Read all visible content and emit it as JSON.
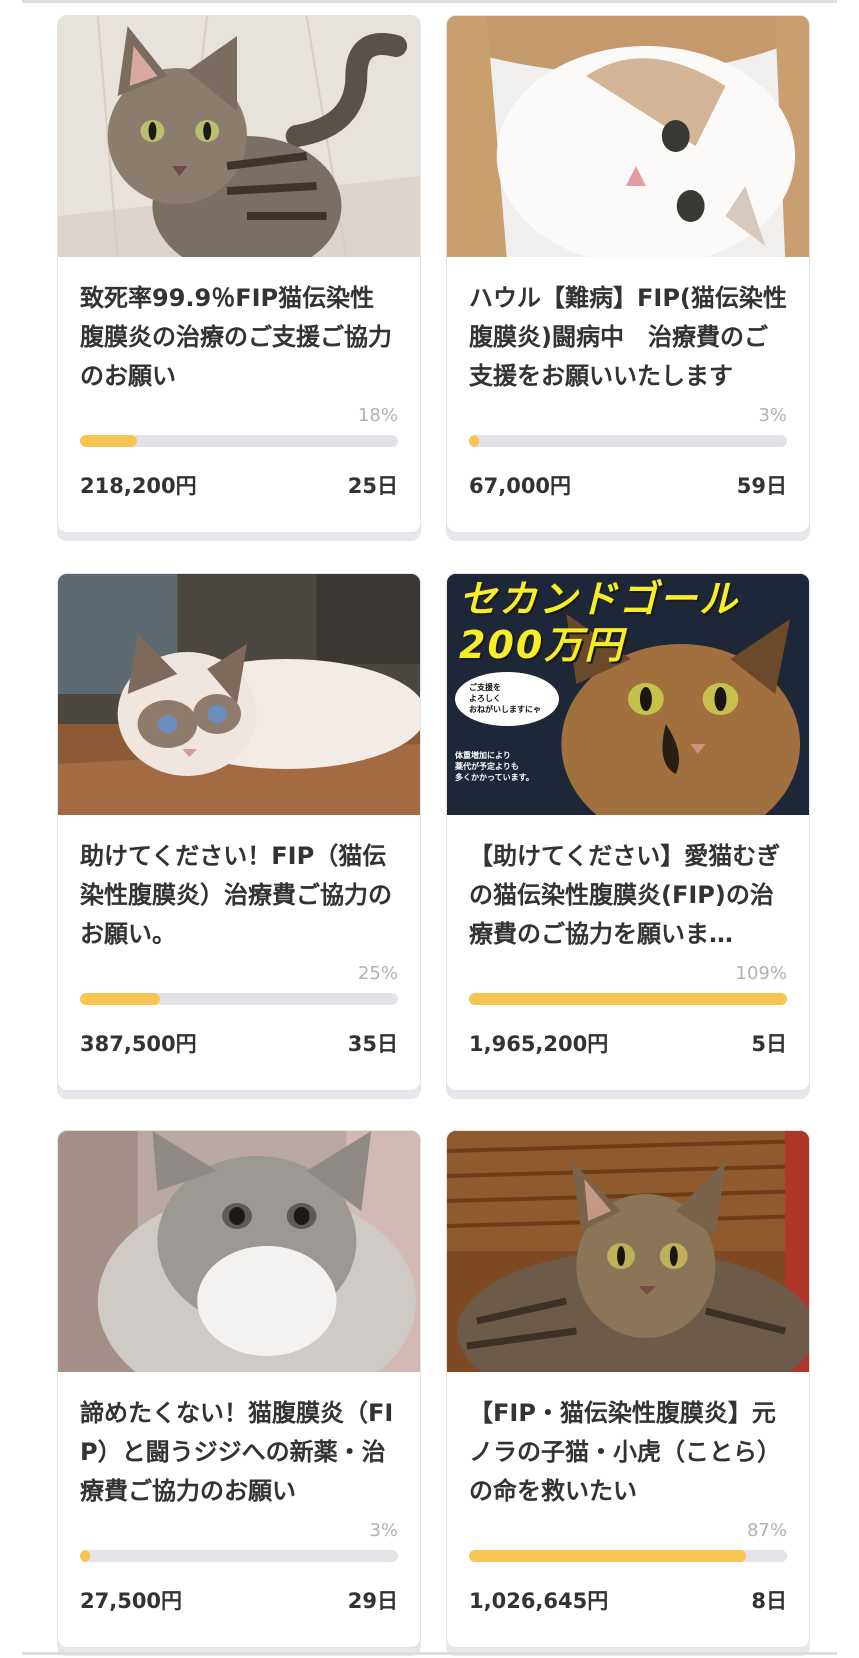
{
  "colors": {
    "progress_fill": "#f8c552",
    "progress_track": "#e2e3e7",
    "percent_text": "#b1b1b6",
    "title_text": "#333333"
  },
  "projects": [
    {
      "image": "tabby-cat-sitting-photo",
      "title": "致死率99.9％FIP猫伝染性腹膜炎の治療のご支援ご協力のお願い",
      "percent": "18%",
      "progress": 0.18,
      "amount": "218,200円",
      "days": "25日"
    },
    {
      "image": "white-cat-in-basket-photo",
      "title": "ハウル【難病】FIP(猫伝染性腹膜炎)闘病中　治療費のご支援をお願いいたします",
      "percent": "3%",
      "progress": 0.03,
      "amount": "67,000円",
      "days": "59日"
    },
    {
      "image": "ragdoll-cat-lying-photo",
      "title": "助けてください！FIP（猫伝染性腹膜炎）治療費ご協力のお願い。",
      "percent": "25%",
      "progress": 0.25,
      "amount": "387,500円",
      "days": "35日"
    },
    {
      "image": "tortoiseshell-cat-photo",
      "image_text": {
        "headline": "セカンドゴール\n200万円",
        "bubble": "ご支援を\nよろしく\nおねがいしますにゃ",
        "note": "体重増加により\n薬代が予定よりも\n多くかかっています。"
      },
      "title": "【助けてください】愛猫むぎの猫伝染性腹膜炎(FIP)の治療費のご協力を願いま…",
      "percent": "109%",
      "progress": 1.0,
      "amount": "1,965,200円",
      "days": "5日"
    },
    {
      "image": "fluffy-grey-kitten-photo",
      "title": "諦めたくない！猫腹膜炎（FIP）と闘うジジへの新薬・治療費ご協力のお願い",
      "percent": "3%",
      "progress": 0.03,
      "amount": "27,500円",
      "days": "29日"
    },
    {
      "image": "tabby-kitten-photo",
      "title": "【FIP・猫伝染性腹膜炎】元ノラの子猫・小虎（ことら）の命を救いたい",
      "percent": "87%",
      "progress": 0.87,
      "amount": "1,026,645円",
      "days": "8日"
    }
  ]
}
